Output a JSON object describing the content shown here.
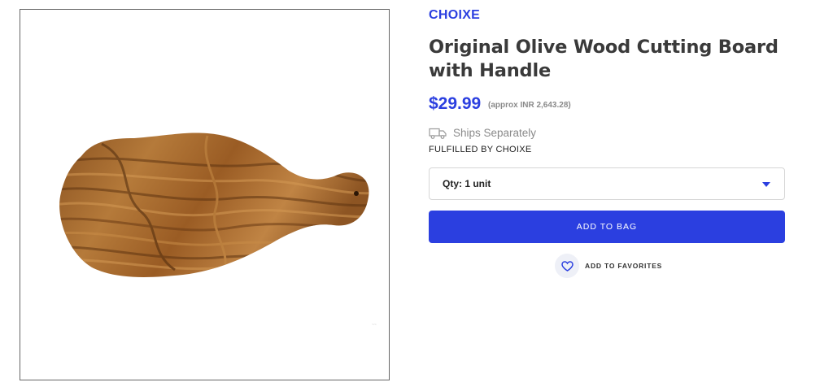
{
  "product": {
    "brand": "CHOIXE",
    "title": "Original Olive Wood Cutting Board with Handle",
    "price": "$29.99",
    "approx_price": "(approx INR 2,643.28)",
    "shipping_text": "Ships Separately",
    "fulfilled_by": "FULFILLED BY CHOIXE",
    "image_icon": "olive-wood-cutting-board"
  },
  "quantity": {
    "selected": "Qty: 1 unit"
  },
  "actions": {
    "add_to_bag": "ADD TO BAG",
    "add_to_favorites": "ADD TO FAVORITES"
  },
  "colors": {
    "accent": "#2b3fe0",
    "muted": "#8a8a8a",
    "wood": "#a8692c"
  }
}
